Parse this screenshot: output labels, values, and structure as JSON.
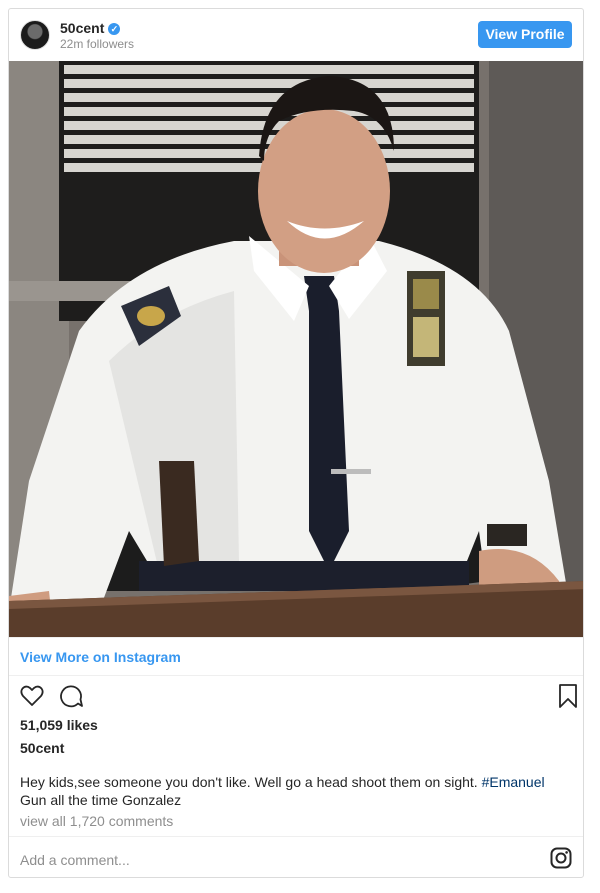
{
  "header": {
    "username": "50cent",
    "verified_mark": "✓",
    "followers": "22m followers",
    "view_profile_label": "View Profile"
  },
  "photo": {
    "alt": "Photo of a smiling police officer in a white uniform shirt and dark tie seated at a desk"
  },
  "view_more_label": "View More on Instagram",
  "actions": {
    "icons": [
      "heart-icon",
      "comment-icon",
      "bookmark-icon"
    ]
  },
  "likes": "51,059 likes",
  "owner": "50cent",
  "caption": {
    "text_before": "Hey kids,see someone you don't like. Well go a head shoot them on sight. ",
    "hashtag": "#Emanuel",
    "text_after": " Gun all the time Gonzalez"
  },
  "comments_link": "view all 1,720 comments",
  "add_comment_placeholder": "Add a comment...",
  "colors": {
    "accent": "#3897f0",
    "hashtag": "#003569",
    "muted": "#8e8e8e",
    "border": "#dbdbdb"
  }
}
